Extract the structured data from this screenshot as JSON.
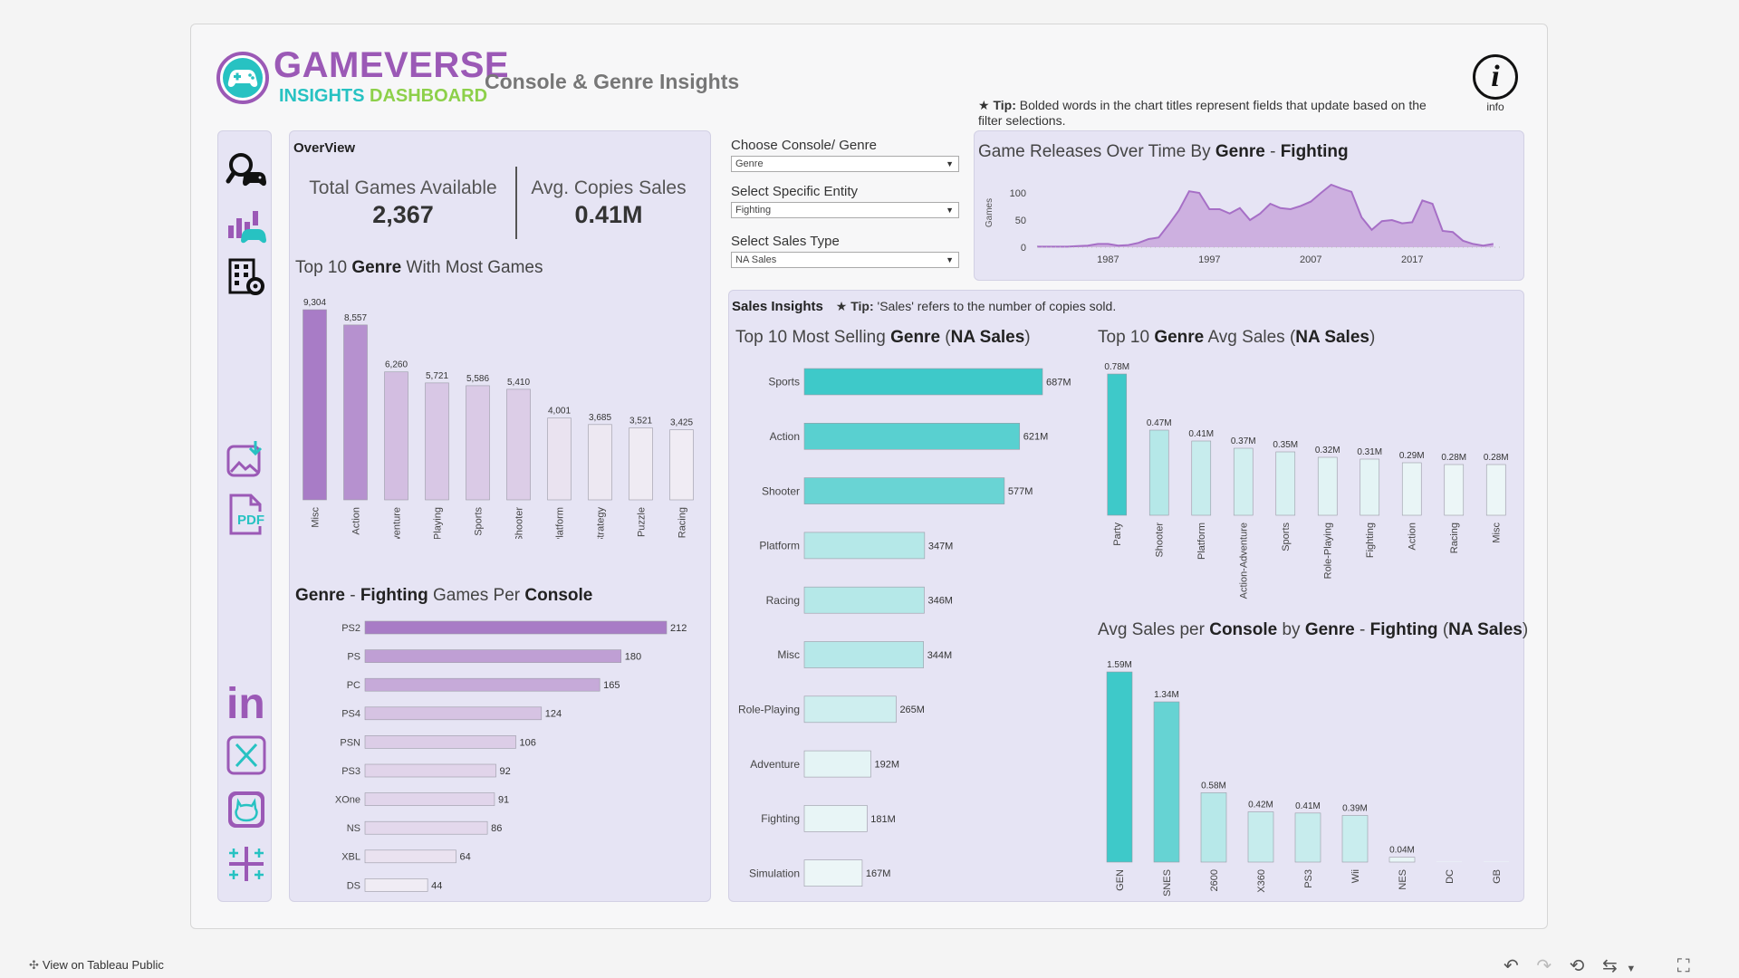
{
  "header": {
    "logo_main": "GAMEVERSE",
    "logo_sub_1": "INSIGHTS",
    "logo_sub_2": "DASHBOARD",
    "page_title": "Console & Genre Insights",
    "tip_star": "★",
    "tip_bold": "Tip:",
    "tip_text": "Bolded words in the chart titles represent fields that update based on the filter selections.",
    "info_label": "info",
    "info_glyph": "i"
  },
  "sidebar": {
    "items": [
      {
        "icon": "search-gamepad-icon"
      },
      {
        "icon": "chart-gamepad-icon"
      },
      {
        "icon": "building-gear-icon"
      },
      {
        "icon": "image-download-icon"
      },
      {
        "icon": "pdf-icon"
      },
      {
        "icon": "linkedin-icon"
      },
      {
        "icon": "x-twitter-icon"
      },
      {
        "icon": "github-icon"
      },
      {
        "icon": "tableau-icon"
      }
    ],
    "pdf_text": "PDF",
    "linkedin_text": "in"
  },
  "overview": {
    "heading": "OverView",
    "total_label": "Total Games Available",
    "total_value": "2,367",
    "avg_label": "Avg. Copies Sales",
    "avg_value": "0.41M"
  },
  "filters": {
    "console_genre_label": "Choose Console/ Genre",
    "console_genre_value": "Genre",
    "entity_label": "Select Specific Entity",
    "entity_value": "Fighting",
    "sales_type_label": "Select Sales Type",
    "sales_type_value": "NA Sales"
  },
  "sales_insights": {
    "heading": "Sales Insights",
    "tip_star": "★",
    "tip_bold": "Tip:",
    "tip_text": "'Sales' refers to the number of copies sold."
  },
  "titles": {
    "top_genre_pre": "Top 10 ",
    "top_genre_bold": "Genre",
    "top_genre_post": " With Most Games",
    "per_console_bold1": "Genre",
    "per_console_mid": " - ",
    "per_console_bold2": "Fighting",
    "per_console_mid2": " Games Per ",
    "per_console_bold3": "Console",
    "releases_pre": "Game Releases Over Time By ",
    "releases_bold1": "Genre",
    "releases_mid": " - ",
    "releases_bold2": "Fighting",
    "selling_pre": "Top 10 Most Selling ",
    "selling_bold1": "Genre",
    "selling_mid": " (",
    "selling_bold2": "NA Sales",
    "selling_post": ")",
    "avg_pre": "Top 10 ",
    "avg_bold1": "Genre",
    "avg_mid": " Avg Sales (",
    "avg_bold2": "NA Sales",
    "avg_post": ")",
    "console_avg_pre": "Avg Sales per ",
    "console_avg_bold1": "Console",
    "console_avg_mid": " by ",
    "console_avg_bold2": "Genre",
    "console_avg_mid2": " - ",
    "console_avg_bold3": "Fighting",
    "console_avg_mid3": " (",
    "console_avg_bold4": "NA Sales",
    "console_avg_post": ")"
  },
  "footer": {
    "view_label": "View on Tableau Public"
  },
  "colors": {
    "purple_dark": "#a87cc6",
    "purple_light": "#f0ecf4",
    "teal_dark": "#3ec9c9",
    "teal_light": "#ecf6f7",
    "brand_purple": "#9b59b6",
    "brand_teal": "#27c2c2",
    "brand_green": "#8dd04a"
  },
  "chart_data": [
    {
      "id": "top-genre-games",
      "type": "bar",
      "categories": [
        "Misc",
        "Action",
        "Adventure",
        "Role-Playing",
        "Sports",
        "Shooter",
        "Platform",
        "Strategy",
        "Puzzle",
        "Racing"
      ],
      "values": [
        9304,
        8557,
        6260,
        5721,
        5586,
        5410,
        4001,
        3685,
        3521,
        3425
      ],
      "labels": [
        "9,304",
        "8,557",
        "6,260",
        "5,721",
        "5,586",
        "5,410",
        "4,001",
        "3,685",
        "3,521",
        "3,425"
      ],
      "title": "Top 10 Genre With Most Games"
    },
    {
      "id": "fighting-per-console",
      "type": "bar",
      "orientation": "horizontal",
      "categories": [
        "PS2",
        "PS",
        "PC",
        "PS4",
        "PSN",
        "PS3",
        "XOne",
        "NS",
        "XBL",
        "DS"
      ],
      "values": [
        212,
        180,
        165,
        124,
        106,
        92,
        91,
        86,
        64,
        44
      ],
      "labels": [
        "212",
        "180",
        "165",
        "124",
        "106",
        "92",
        "91",
        "86",
        "64",
        "44"
      ],
      "title": "Genre - Fighting Games Per Console"
    },
    {
      "id": "releases-over-time",
      "type": "area",
      "title": "Game Releases Over Time By Genre - Fighting",
      "ylabel": "Games",
      "ylim": [
        0,
        130
      ],
      "yticks": [
        "100",
        "50",
        "0"
      ],
      "ytick_values": [
        100,
        50,
        0
      ],
      "xticks": [
        "1987",
        "1997",
        "2007",
        "2017"
      ],
      "xtick_values": [
        1987,
        1997,
        2007,
        2017
      ],
      "xlim": [
        1980,
        2026
      ],
      "x": [
        1980,
        1981,
        1982,
        1983,
        1984,
        1985,
        1986,
        1987,
        1988,
        1989,
        1990,
        1991,
        1992,
        1993,
        1994,
        1995,
        1996,
        1997,
        1998,
        1999,
        2000,
        2001,
        2002,
        2003,
        2004,
        2005,
        2006,
        2007,
        2008,
        2009,
        2010,
        2011,
        2012,
        2013,
        2014,
        2015,
        2016,
        2017,
        2018,
        2019,
        2020,
        2021,
        2022,
        2023,
        2024,
        2025
      ],
      "y": [
        1,
        1,
        1,
        1,
        2,
        3,
        6,
        6,
        3,
        4,
        8,
        15,
        18,
        42,
        68,
        103,
        100,
        70,
        70,
        62,
        72,
        50,
        62,
        80,
        72,
        70,
        76,
        84,
        100,
        115,
        108,
        102,
        55,
        32,
        48,
        50,
        44,
        46,
        86,
        80,
        30,
        28,
        12,
        6,
        3,
        6
      ]
    },
    {
      "id": "top-selling-genre",
      "type": "bar",
      "orientation": "horizontal",
      "categories": [
        "Sports",
        "Action",
        "Shooter",
        "Platform",
        "Racing",
        "Misc",
        "Role-Playing",
        "Adventure",
        "Fighting",
        "Simulation"
      ],
      "values": [
        687,
        621,
        577,
        347,
        346,
        344,
        265,
        192,
        181,
        167
      ],
      "labels": [
        "687M",
        "621M",
        "577M",
        "347M",
        "346M",
        "344M",
        "265M",
        "192M",
        "181M",
        "167M"
      ],
      "title": "Top 10 Most Selling Genre (NA Sales)"
    },
    {
      "id": "genre-avg-sales",
      "type": "bar",
      "categories": [
        "Party",
        "Shooter",
        "Platform",
        "Action-Adventure",
        "Sports",
        "Role-Playing",
        "Fighting",
        "Action",
        "Racing",
        "Misc"
      ],
      "values": [
        0.78,
        0.47,
        0.41,
        0.37,
        0.35,
        0.32,
        0.31,
        0.29,
        0.28,
        0.28
      ],
      "labels": [
        "0.78M",
        "0.47M",
        "0.41M",
        "0.37M",
        "0.35M",
        "0.32M",
        "0.31M",
        "0.29M",
        "0.28M",
        "0.28M"
      ],
      "title": "Top 10 Genre Avg Sales (NA Sales)"
    },
    {
      "id": "console-avg-sales",
      "type": "bar",
      "categories": [
        "GEN",
        "SNES",
        "2600",
        "X360",
        "PS3",
        "Wii",
        "NES",
        "DC",
        "GB"
      ],
      "values": [
        1.59,
        1.34,
        0.58,
        0.42,
        0.41,
        0.39,
        0.04,
        0,
        0
      ],
      "labels": [
        "1.59M",
        "1.34M",
        "0.58M",
        "0.42M",
        "0.41M",
        "0.39M",
        "0.04M",
        "",
        ""
      ],
      "title": "Avg Sales per Console by Genre - Fighting (NA Sales)"
    }
  ]
}
